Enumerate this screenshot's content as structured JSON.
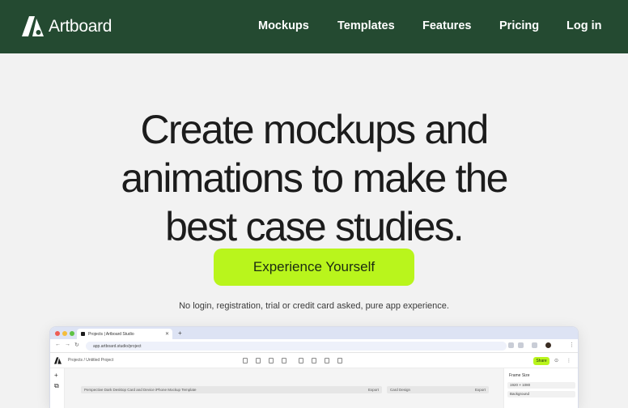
{
  "nav": {
    "brand": "Artboard",
    "links": [
      "Mockups",
      "Templates",
      "Features",
      "Pricing",
      "Log in"
    ]
  },
  "hero": {
    "title_lines": [
      "Create mockups and",
      "animations to make the",
      "best case studies."
    ],
    "cta_label": "Experience Yourself",
    "note": "No login, registration, trial or credit card asked, pure app experience."
  },
  "preview": {
    "tab_title": "Projects | Artboard Studio",
    "new_tab": "+",
    "url": "app.artboard.studio/project",
    "breadcrumb": "Projects / Untitled Project",
    "share_label": "Share",
    "frame_left": "Perspective Dark Desktop Card and Device iPhone Mockup Template",
    "frame_left_action": "Export",
    "frame_right": "Card Design",
    "frame_right_action": "Export",
    "panel_title": "Frame Size",
    "panel_rows": [
      "1920 × 1080",
      "Background"
    ]
  },
  "colors": {
    "nav_bg": "#244a31",
    "accent": "#b9f51c",
    "page_bg": "#f2f2f2"
  }
}
